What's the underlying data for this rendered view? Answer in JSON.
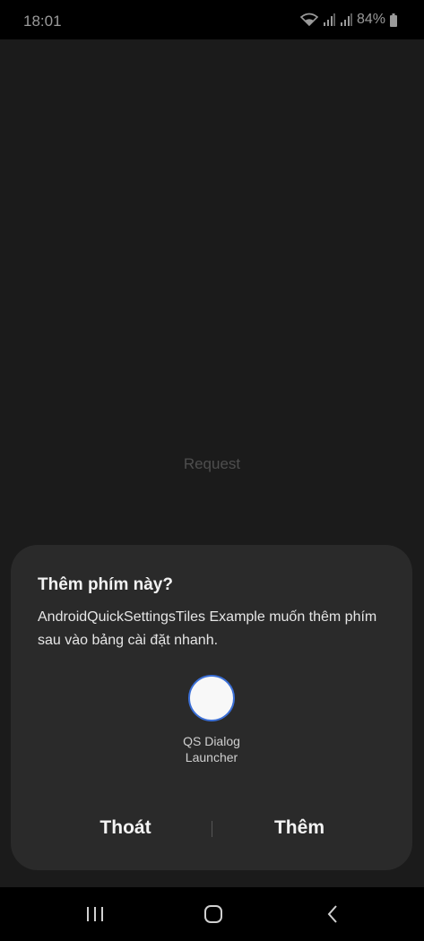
{
  "status_bar": {
    "time": "18:01",
    "battery_percent": "84%",
    "icons": [
      "wifi-icon",
      "signal-icon",
      "signal-icon",
      "battery-icon"
    ]
  },
  "app": {
    "request_label": "Request"
  },
  "dialog": {
    "title": "Thêm phím này?",
    "body": "AndroidQuickSettingsTiles Example muốn thêm phím sau vào bảng cài đặt nhanh.",
    "tile_label_line1": "QS Dialog",
    "tile_label_line2": "Launcher",
    "cancel_label": "Thoát",
    "add_label": "Thêm"
  },
  "nav_bar": {
    "icons": [
      "recents-icon",
      "home-icon",
      "back-icon"
    ]
  },
  "colors": {
    "accent": "#3b6fd6",
    "dialog_bg": "#2a2a2a",
    "screen_bg": "#1b1b1b"
  }
}
